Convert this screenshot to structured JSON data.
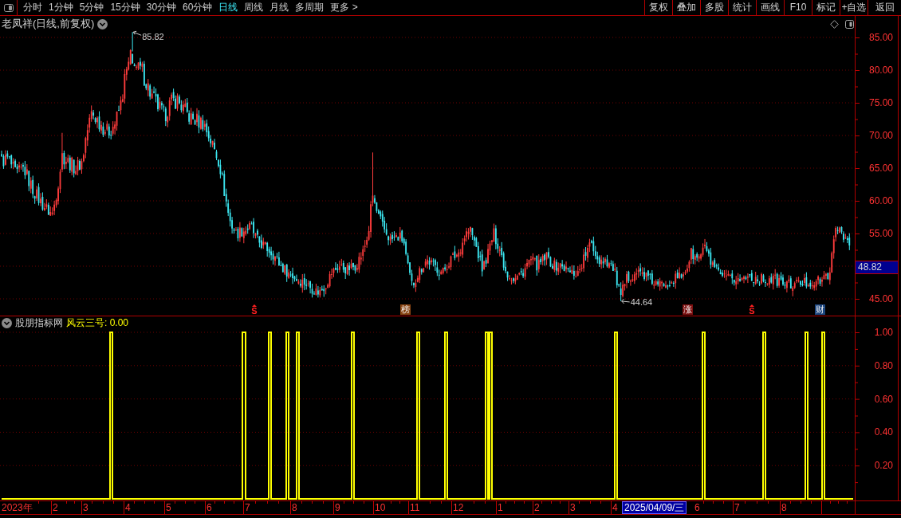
{
  "toolbar": {
    "tabs": [
      {
        "label": "分时",
        "selected": false
      },
      {
        "label": "1分钟",
        "selected": false
      },
      {
        "label": "5分钟",
        "selected": false
      },
      {
        "label": "15分钟",
        "selected": false
      },
      {
        "label": "30分钟",
        "selected": false
      },
      {
        "label": "60分钟",
        "selected": false
      },
      {
        "label": "日线",
        "selected": true
      },
      {
        "label": "周线",
        "selected": false
      },
      {
        "label": "月线",
        "selected": false
      },
      {
        "label": "多周期",
        "selected": false
      },
      {
        "label": "更多 >",
        "selected": false
      }
    ],
    "buttons": [
      "复权",
      "叠加",
      "多股",
      "统计",
      "画线",
      "F10",
      "标记",
      "+自选",
      "返回"
    ]
  },
  "price_panel": {
    "title": "老凤祥(日线,前复权)",
    "high_label": "85.82",
    "low_label": "44.64",
    "axis_labels": [
      "85.00",
      "80.00",
      "75.00",
      "70.00",
      "65.00",
      "60.00",
      "55.00",
      "45.00"
    ],
    "current_price": "48.82",
    "event_markers": [
      {
        "kind": "split",
        "text": "S"
      },
      {
        "kind": "tag",
        "text": "榜",
        "color": "#8a4513"
      },
      {
        "kind": "tag",
        "text": "涨",
        "color": "#7d0f0f"
      },
      {
        "kind": "split",
        "text": "S"
      },
      {
        "kind": "tag",
        "text": "财",
        "color": "#1d4780"
      }
    ]
  },
  "indicator_panel": {
    "source": "股朋指标网",
    "reading": "风云三号: 0.00",
    "axis_labels": [
      "1.00",
      "0.80",
      "0.60",
      "0.40",
      "0.20"
    ]
  },
  "time_axis": {
    "labels": [
      "2023年",
      "2",
      "3",
      "4",
      "5",
      "6",
      "7",
      "8",
      "9",
      "10",
      "11",
      "12",
      "1",
      "2",
      "3",
      "4",
      "6",
      "7",
      "8"
    ],
    "cursor_date": "2025/04/09/三"
  }
}
